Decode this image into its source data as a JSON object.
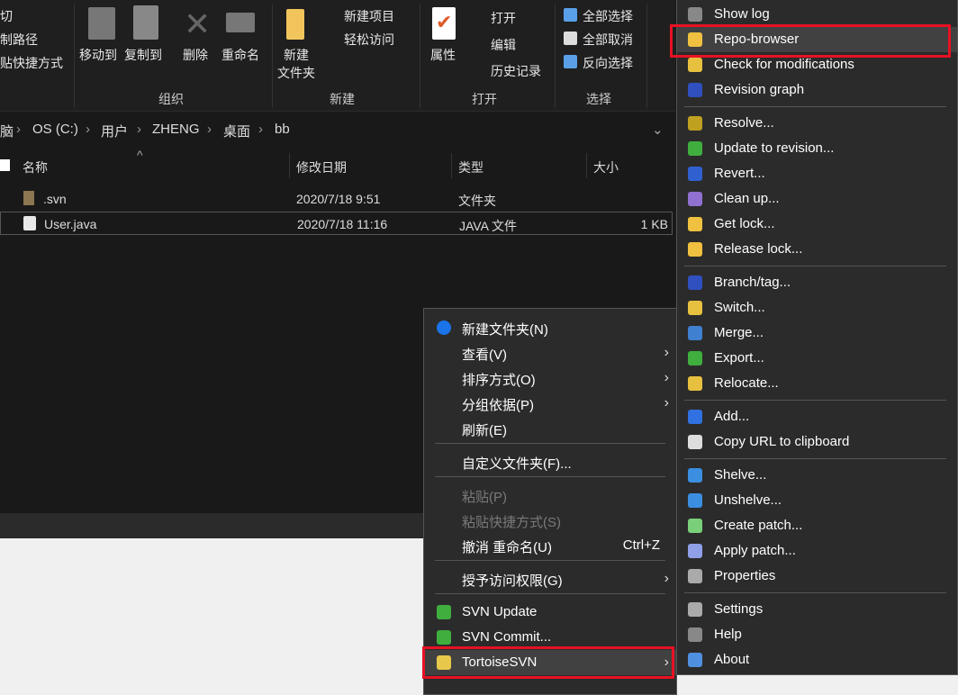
{
  "ribbon": {
    "clipboard_partial": [
      "切",
      "制路径",
      "贴快捷方式"
    ],
    "organize": {
      "move_to": "移动到",
      "copy_to": "复制到",
      "delete": "删除",
      "rename": "重命名",
      "group": "组织"
    },
    "new": {
      "new_folder_1": "新建",
      "new_folder_2": "文件夹",
      "new_item": "新建项目",
      "easy_access": "轻松访问",
      "group": "新建"
    },
    "open": {
      "properties": "属性",
      "open": "打开",
      "edit": "编辑",
      "history": "历史记录",
      "group": "打开"
    },
    "select": {
      "select_all": "全部选择",
      "select_none": "全部取消",
      "invert": "反向选择",
      "group": "选择"
    }
  },
  "address": {
    "crumbs": [
      "脑",
      "OS (C:)",
      "用户",
      "ZHENG",
      "桌面",
      "bb"
    ]
  },
  "columns": [
    "名称",
    "修改日期",
    "类型",
    "大小"
  ],
  "files": [
    {
      "name": ".svn",
      "date": "2020/7/18 9:51",
      "type": "文件夹",
      "size": ""
    },
    {
      "name": "User.java",
      "date": "2020/7/18 11:16",
      "type": "JAVA 文件",
      "size": "1 KB"
    }
  ],
  "context_menu": {
    "items": [
      {
        "label": "新建文件夹(N)",
        "icon": "new-folder-icon",
        "color": "#1a73e8"
      },
      {
        "label": "查看(V)",
        "sub": true
      },
      {
        "label": "排序方式(O)",
        "sub": true
      },
      {
        "label": "分组依据(P)",
        "sub": true
      },
      {
        "label": "刷新(E)"
      },
      {
        "label": "自定义文件夹(F)..."
      },
      {
        "label": "粘贴(P)",
        "disabled": true
      },
      {
        "label": "粘贴快捷方式(S)",
        "disabled": true
      },
      {
        "label": "撤消 重命名(U)",
        "shortcut": "Ctrl+Z"
      },
      {
        "label": "授予访问权限(G)",
        "sub": true
      },
      {
        "label": "SVN Update",
        "icon": "svn-update-icon"
      },
      {
        "label": "SVN Commit...",
        "icon": "svn-commit-icon"
      },
      {
        "label": "TortoiseSVN",
        "icon": "tortoisesvn-icon",
        "sub": true,
        "highlighted": true
      }
    ]
  },
  "svn_menu": {
    "items": [
      "Show log",
      "Repo-browser",
      "Check for modifications",
      "Revision graph",
      "Resolve...",
      "Update to revision...",
      "Revert...",
      "Clean up...",
      "Get lock...",
      "Release lock...",
      "Branch/tag...",
      "Switch...",
      "Merge...",
      "Export...",
      "Relocate...",
      "Add...",
      "Copy URL to clipboard",
      "Shelve...",
      "Unshelve...",
      "Create patch...",
      "Apply patch...",
      "Properties",
      "Settings",
      "Help",
      "About"
    ],
    "highlighted": "Repo-browser"
  },
  "colors": {
    "highlight_border": "#e81123",
    "menu_bg": "#2b2b2b",
    "explorer_bg": "#191919"
  }
}
